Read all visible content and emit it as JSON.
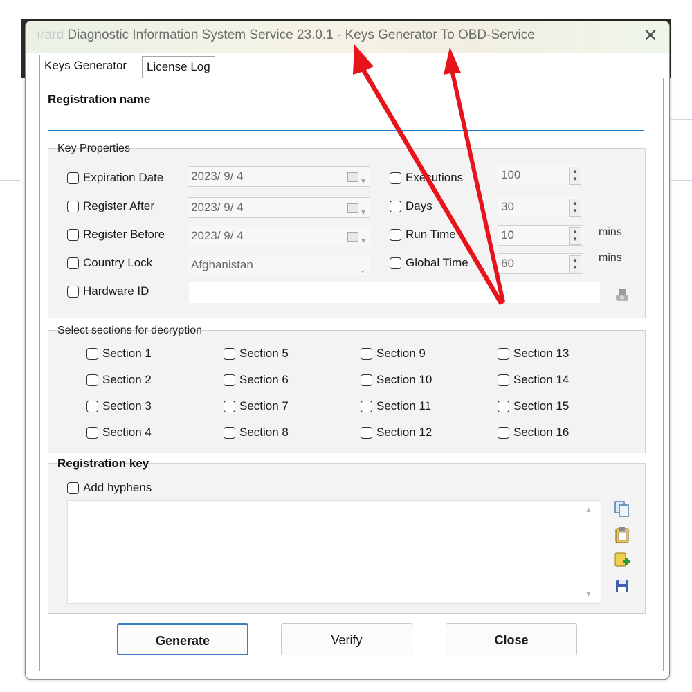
{
  "window": {
    "title_prefix": "ırard",
    "title_rest": " Diagnostic Information System Service 23.0.1 - Keys Generator To OBD-Service",
    "close_glyph": "✕"
  },
  "tabs": [
    {
      "label": "Keys Generator",
      "active": true
    },
    {
      "label": "License Log",
      "active": false
    }
  ],
  "registration": {
    "name_label": "Registration name",
    "name_value": ""
  },
  "key_properties": {
    "title": "Key Properties",
    "left_options": [
      {
        "label": "Expiration Date",
        "value": "2023/  9/  4"
      },
      {
        "label": "Register After",
        "value": "2023/  9/  4"
      },
      {
        "label": "Register Before",
        "value": "2023/  9/  4"
      },
      {
        "label": "Country Lock",
        "value": "Afghanistan"
      },
      {
        "label": "Hardware ID",
        "value": ""
      }
    ],
    "right_options": [
      {
        "label": "Executions",
        "value": "100",
        "unit": ""
      },
      {
        "label": "Days",
        "value": "30",
        "unit": ""
      },
      {
        "label": "Run Time",
        "value": "10",
        "unit": "mins"
      },
      {
        "label": "Global Time",
        "value": "60",
        "unit": "mins"
      }
    ]
  },
  "sections": {
    "title": "Select sections for decryption",
    "items": [
      "Section 1",
      "Section 2",
      "Section 3",
      "Section 4",
      "Section 5",
      "Section 6",
      "Section 7",
      "Section 8",
      "Section 9",
      "Section 10",
      "Section 11",
      "Section 12",
      "Section 13",
      "Section 14",
      "Section 15",
      "Section 16"
    ]
  },
  "registration_key": {
    "title": "Registration key",
    "hyphens_label": "Add hyphens",
    "value": ""
  },
  "buttons": {
    "generate": "Generate",
    "verify": "Verify",
    "close": "Close"
  },
  "colors": {
    "accent": "#1e78c8",
    "arrow": "#e8141b"
  }
}
